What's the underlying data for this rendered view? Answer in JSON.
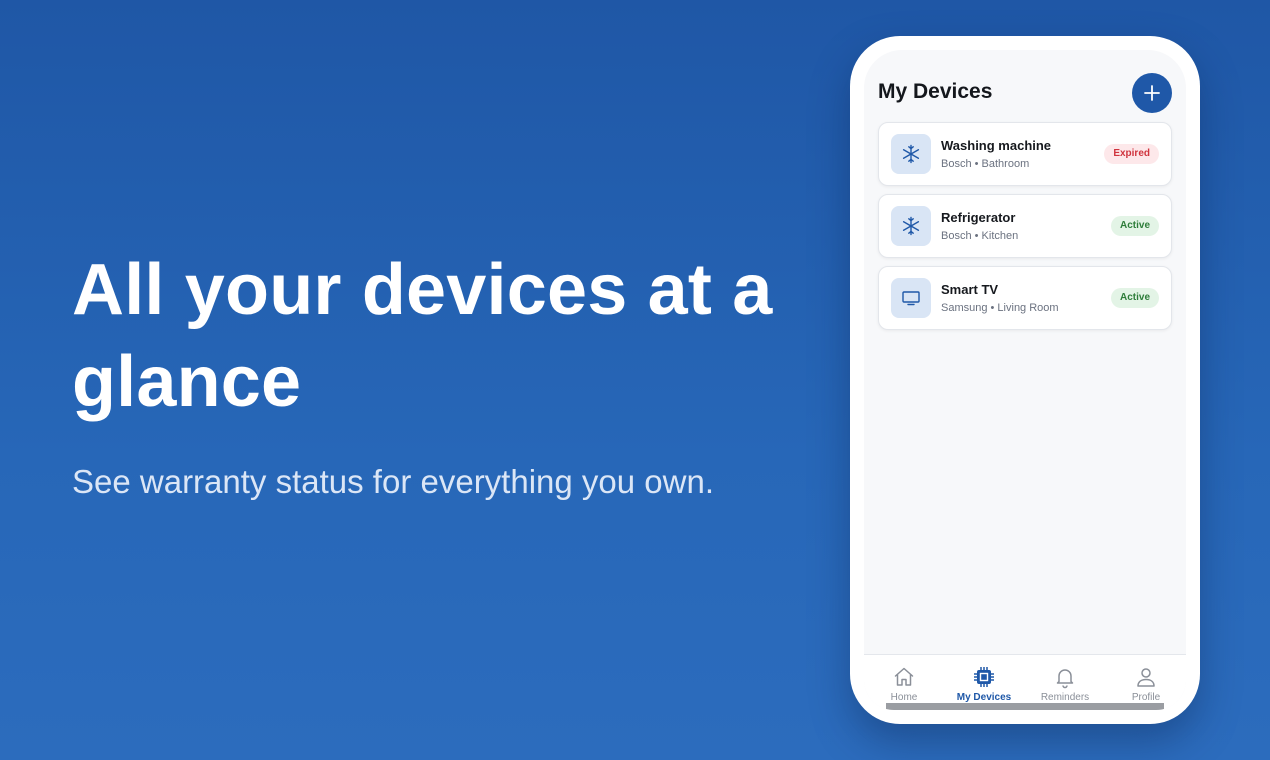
{
  "hero": {
    "title": "All your devices at a glance",
    "subtitle": "See warranty status for everything you own."
  },
  "app": {
    "screen_title": "My Devices",
    "add_button_icon": "plus-icon",
    "devices": [
      {
        "name": "Washing machine",
        "meta": "Bosch • Bathroom",
        "status": "Expired",
        "icon": "snowflake-icon"
      },
      {
        "name": "Refrigerator",
        "meta": "Bosch • Kitchen",
        "status": "Active",
        "icon": "snowflake-icon"
      },
      {
        "name": "Smart TV",
        "meta": "Samsung • Living Room",
        "status": "Active",
        "icon": "tv-icon"
      }
    ],
    "nav": [
      {
        "label": "Home",
        "icon": "home-icon",
        "active": false
      },
      {
        "label": "My Devices",
        "icon": "chip-icon",
        "active": true
      },
      {
        "label": "Reminders",
        "icon": "bell-icon",
        "active": false
      },
      {
        "label": "Profile",
        "icon": "person-icon",
        "active": false
      }
    ]
  },
  "colors": {
    "background": "#2463b3",
    "accent": "#1f58a8",
    "expired_text": "#d0343e",
    "expired_bg": "#fde8ea",
    "active_text": "#2e7d3a",
    "active_bg": "#e3f4e6"
  }
}
